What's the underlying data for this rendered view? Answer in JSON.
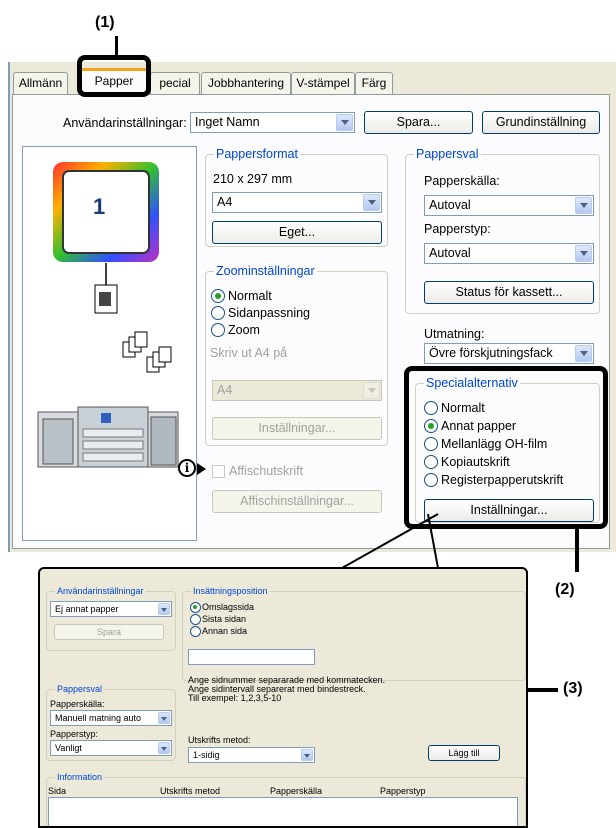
{
  "callouts": {
    "c1": "(1)",
    "c2": "(2)",
    "c3": "(3)"
  },
  "tabs": [
    "Allmänn",
    "Papper",
    "pecial",
    "Jobbhantering",
    "V-stämpel",
    "Färg"
  ],
  "user_settings": {
    "label": "Användarinställningar:",
    "value": "Inget Namn",
    "save": "Spara...",
    "default": "Grundinställning"
  },
  "preview": {
    "page_number": "1"
  },
  "paper_size": {
    "title": "Pappersformat",
    "dims": "210 x 297 mm",
    "value": "A4",
    "custom": "Eget..."
  },
  "zoom": {
    "title": "Zoominställningar",
    "opt1": "Normalt",
    "opt2": "Sidanpassning",
    "opt3": "Zoom",
    "fit_label": "Skriv ut A4 på",
    "fit_value": "A4",
    "settings": "Inställningar..."
  },
  "poster": {
    "label": "Affischutskrift",
    "button": "Affischinställningar..."
  },
  "paper_select": {
    "title": "Pappersval",
    "source_label": "Papperskälla:",
    "source_value": "Autoval",
    "type_label": "Papperstyp:",
    "type_value": "Autoval",
    "status": "Status för kassett..."
  },
  "output": {
    "label": "Utmatning:",
    "value": "Övre förskjutningsfack"
  },
  "special": {
    "title": "Specialalternativ",
    "opt1": "Normalt",
    "opt2": "Annat papper",
    "opt3": "Mellanlägg OH-film",
    "opt4": "Kopiautskrift",
    "opt5": "Registerpapperutskrift",
    "settings": "Inställningar..."
  },
  "sub": {
    "user_title": "Användarinställningar",
    "user_value": "Ej annat papper",
    "save": "Spara",
    "insert_title": "Insättningsposition",
    "r1": "Omslagssida",
    "r2": "Sista sidan",
    "r3": "Annan sida",
    "hint1": "Ange sidnummer separarade med kommatecken.",
    "hint2": "Ange sidintervall separerat med bindestreck.",
    "hint3": "Till exempel:  1,2,3,5-10",
    "paper_title": "Pappersval",
    "source_label": "Papperskälla:",
    "source_value": "Manuell matning auto",
    "type_label": "Papperstyp:",
    "type_value": "Vanligt",
    "method_label": "Utskrifts metod:",
    "method_value": "1-sidig",
    "add": "Lägg till",
    "info_title": "Information",
    "col1": "Sida",
    "col2": "Utskrifts metod",
    "col3": "Papperskälla",
    "col4": "Papperstyp"
  }
}
